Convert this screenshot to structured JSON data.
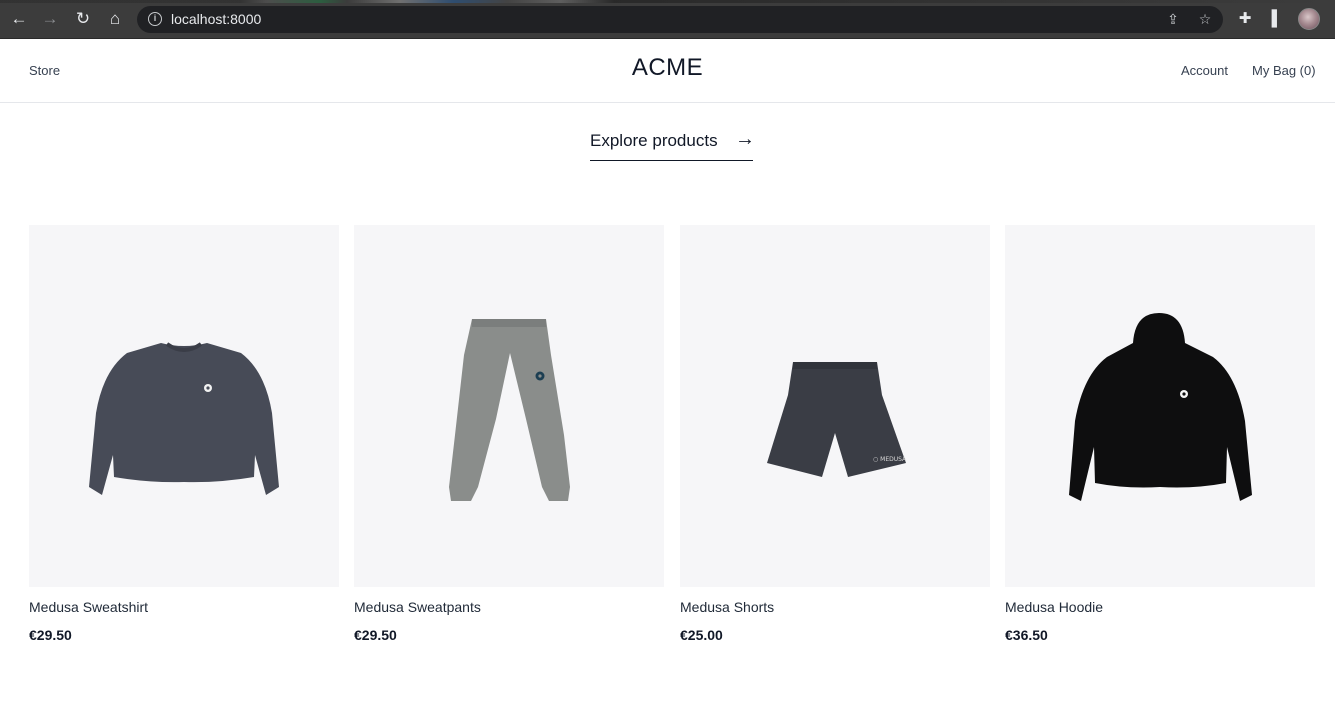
{
  "browser": {
    "url": "localhost:8000"
  },
  "header": {
    "store_label": "Store",
    "brand": "ACME",
    "account_label": "Account",
    "bag_label": "My Bag (0)"
  },
  "hero": {
    "explore_label": "Explore products",
    "arrow": "→"
  },
  "products": [
    {
      "name": "Medusa Sweatshirt",
      "price": "€29.50",
      "image": "sweatshirt-image",
      "color": "#474b57"
    },
    {
      "name": "Medusa Sweatpants",
      "price": "€29.50",
      "image": "sweatpants-image",
      "color": "#8a8d8b"
    },
    {
      "name": "Medusa Shorts",
      "price": "€25.00",
      "image": "shorts-image",
      "color": "#3a3d45"
    },
    {
      "name": "Medusa Hoodie",
      "price": "€36.50",
      "image": "hoodie-image",
      "color": "#0e0e0f"
    }
  ]
}
